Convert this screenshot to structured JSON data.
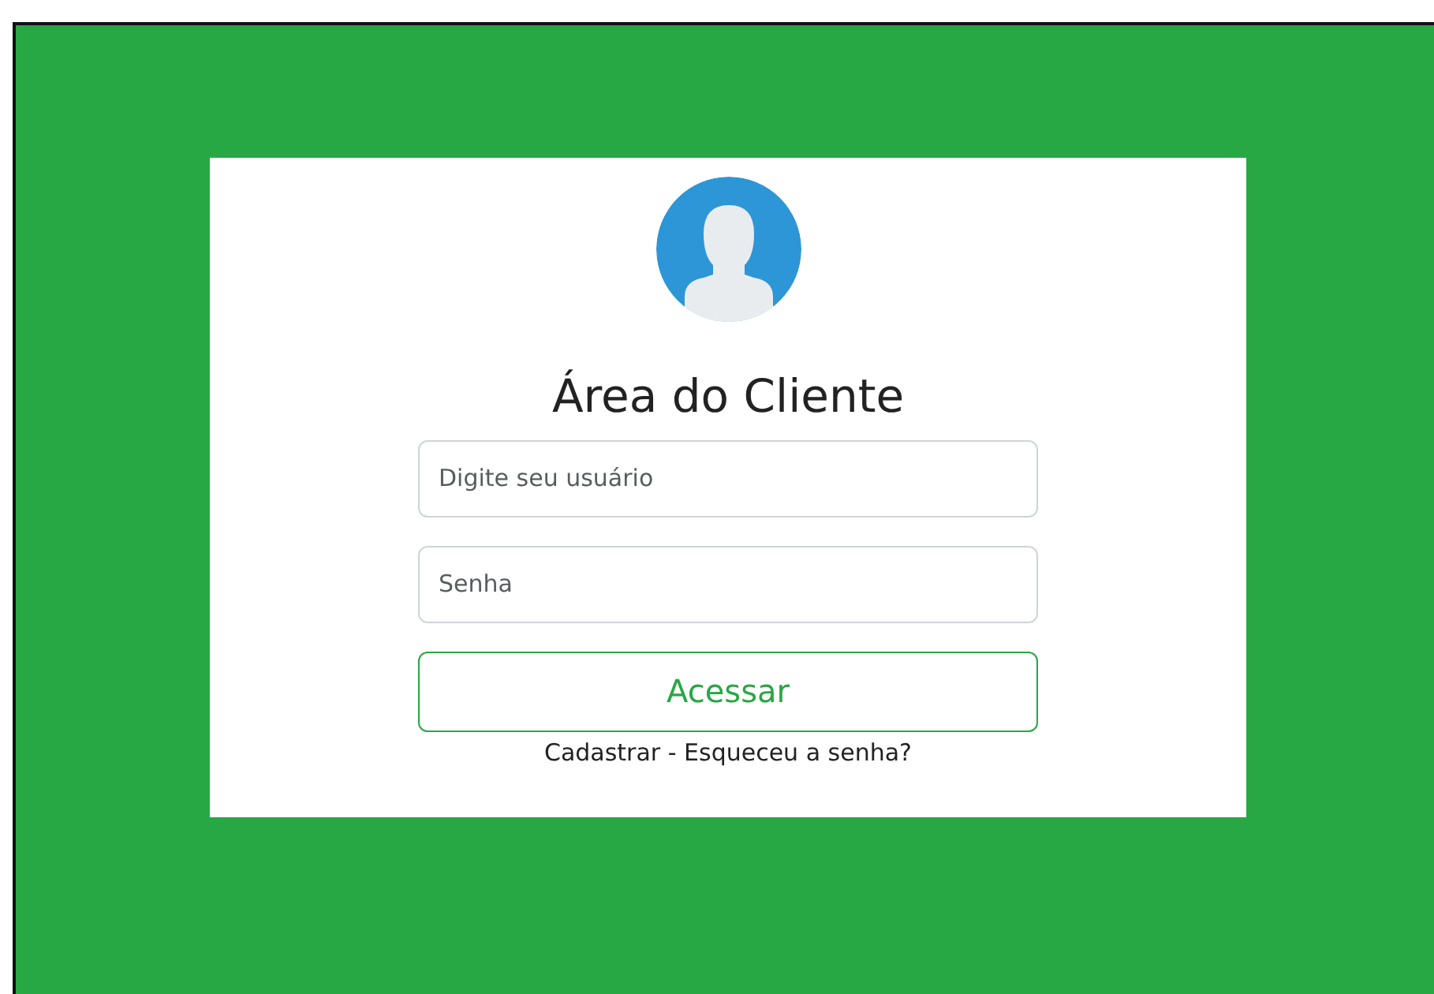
{
  "login": {
    "title": "Área do Cliente",
    "fields": [
      {
        "placeholder": "Digite seu usuário"
      },
      {
        "placeholder": "Senha"
      }
    ],
    "submit": "Acessar",
    "links": [
      "Cadastrar",
      "Esqueceu a senha?"
    ],
    "separator": "-"
  }
}
